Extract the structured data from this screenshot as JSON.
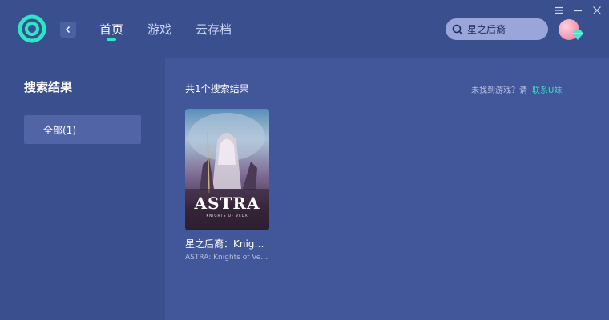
{
  "header": {
    "tabs": [
      {
        "label": "首页",
        "active": true
      },
      {
        "label": "游戏",
        "active": false
      },
      {
        "label": "云存档",
        "active": false
      }
    ],
    "search_value": "星之后裔"
  },
  "sidebar": {
    "title": "搜索结果",
    "items": [
      {
        "label": "全部(1)",
        "selected": true
      }
    ]
  },
  "main": {
    "result_count": "共1个搜索结果",
    "hint_text": "未找到游戏？请",
    "hint_link": "联系U妹",
    "results": [
      {
        "cover_title": "ASTRA",
        "cover_subtitle": "KNIGHTS OF VEDA",
        "title": "星之后裔：Knights of Veda",
        "subtitle": "ASTRA: Knights of Veda"
      }
    ]
  },
  "colors": {
    "accent": "#2ee6c6",
    "background": "#3a4d8c",
    "link": "#34e0c9"
  },
  "icons": [
    "app-logo-icon",
    "back-arrow-icon",
    "search-icon",
    "menu-icon",
    "minimize-icon",
    "close-icon",
    "vip-gem-icon"
  ]
}
